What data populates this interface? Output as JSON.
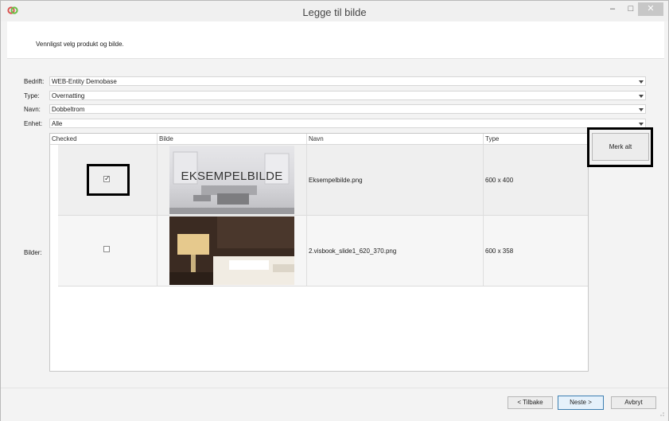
{
  "window": {
    "title": "Legge til bilde",
    "minimize": "–",
    "maximize": "□",
    "close": "✕"
  },
  "header": {
    "instruction": "Vennligst velg produkt og bilde."
  },
  "form": {
    "company": {
      "label": "Bedrift:",
      "value": "WEB-Entity Demobase"
    },
    "type": {
      "label": "Type:",
      "value": "Overnatting"
    },
    "name": {
      "label": "Navn:",
      "value": "Dobbeltrom"
    },
    "unit": {
      "label": "Enhet:",
      "value": "Alle"
    },
    "images_label": "Bilder:"
  },
  "grid": {
    "columns": [
      "Checked",
      "Bilde",
      "Navn",
      "Type"
    ],
    "rows": [
      {
        "checked": true,
        "image_caption": "EKSEMPELBILDE",
        "name": "Eksempelbilde.png",
        "type": "600 x 400",
        "check_glyph": "✓"
      },
      {
        "checked": false,
        "image_caption": "",
        "name": "2.visbook_slide1_620_370.png",
        "type": "600 x 358",
        "check_glyph": ""
      }
    ]
  },
  "buttons": {
    "select_all": "Merk alt",
    "back": "< Tilbake",
    "next": "Neste >",
    "cancel": "Avbryt"
  },
  "icons": {
    "app": "app-logo-icon",
    "dropdown": "chevron-down-icon",
    "resize": "resize-grip-icon"
  },
  "colors": {
    "accent_button": "#e5f1fb",
    "accent_border": "#3c7fb1"
  }
}
